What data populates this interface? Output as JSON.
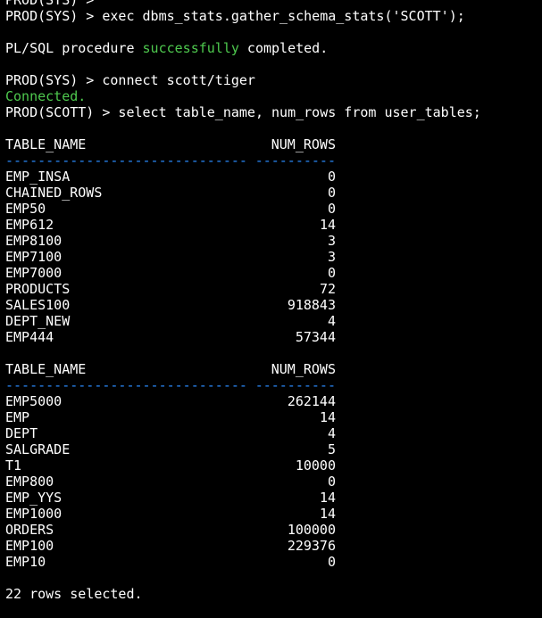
{
  "terminal": {
    "lines_top": [
      {
        "text": "PROD(SYS) >"
      },
      {
        "text": "PROD(SYS) > exec dbms_stats.gather_schema_stats('SCOTT');"
      }
    ],
    "result1": {
      "prefix": "PL/SQL procedure ",
      "highlight": "successfully",
      "suffix": " completed."
    },
    "connect_cmd": "PROD(SYS) > connect scott/tiger",
    "connected_msg": "Connected.",
    "select_cmd": "PROD(SCOTT) > select table_name, num_rows from user_tables;",
    "colors": {
      "background": "#000000",
      "text": "#ffffff",
      "green": "#4ec94e",
      "blue": "#2b8cff"
    },
    "table_headers": {
      "name": "TABLE_NAME",
      "rows": "NUM_ROWS",
      "name_dashes": "------------------------------",
      "rows_dashes": "----------"
    },
    "block1": [
      {
        "name": "EMP_INSA",
        "rows": "0"
      },
      {
        "name": "CHAINED_ROWS",
        "rows": "0"
      },
      {
        "name": "EMP50",
        "rows": "0"
      },
      {
        "name": "EMP612",
        "rows": "14"
      },
      {
        "name": "EMP8100",
        "rows": "3"
      },
      {
        "name": "EMP7100",
        "rows": "3"
      },
      {
        "name": "EMP7000",
        "rows": "0"
      },
      {
        "name": "PRODUCTS",
        "rows": "72"
      },
      {
        "name": "SALES100",
        "rows": "918843"
      },
      {
        "name": "DEPT_NEW",
        "rows": "4"
      },
      {
        "name": "EMP444",
        "rows": "57344"
      }
    ],
    "block2": [
      {
        "name": "EMP5000",
        "rows": "262144"
      },
      {
        "name": "EMP",
        "rows": "14"
      },
      {
        "name": "DEPT",
        "rows": "4"
      },
      {
        "name": "SALGRADE",
        "rows": "5"
      },
      {
        "name": "T1",
        "rows": "10000"
      },
      {
        "name": "EMP800",
        "rows": "0"
      },
      {
        "name": "EMP_YYS",
        "rows": "14"
      },
      {
        "name": "EMP1000",
        "rows": "14"
      },
      {
        "name": "ORDERS",
        "rows": "100000"
      },
      {
        "name": "EMP100",
        "rows": "229376"
      },
      {
        "name": "EMP10",
        "rows": "0"
      }
    ],
    "footer": "22 rows selected."
  }
}
